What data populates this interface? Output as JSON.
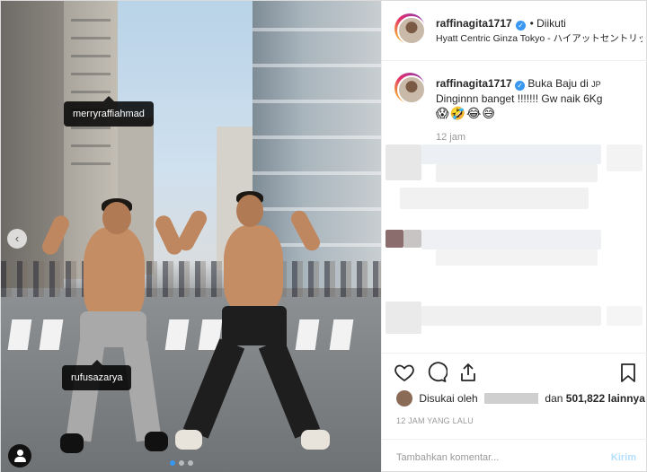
{
  "post": {
    "author": "raffinagita1717",
    "follow_status": "• Diikuti",
    "location": "Hyatt Centric Ginza Tokyo - ハイアットセントリック銀座東京",
    "caption_author": "raffinagita1717",
    "caption_line1": "Buka Baju di",
    "caption_jp_badge": "JP",
    "caption_line2": "Dinginnn banget !!!!!!! Gw naik 6Kg",
    "caption_emojis": "😱🤣😂😅",
    "time_ago": "12 jam",
    "liked_by_prefix": "Disukai oleh",
    "liked_by_suffix": "dan",
    "likes_count": "501,822",
    "likes_suffix": "lainnya",
    "date": "12 JAM YANG LALU",
    "comment_placeholder": "Tambahkan komentar...",
    "post_button": "Kirim"
  },
  "photo": {
    "tags": [
      "merryraffiahmad",
      "rufusazarya"
    ],
    "carousel_dots": 3,
    "active_dot": 0
  },
  "icons": [
    "heart-icon",
    "comment-icon",
    "share-icon",
    "bookmark-icon",
    "chevron-left-icon",
    "user-tag-icon",
    "verified-badge-icon"
  ],
  "colors": {
    "verified": "#3897f0",
    "post_button_disabled": "#b2dffc",
    "secondary_text": "#999999"
  }
}
